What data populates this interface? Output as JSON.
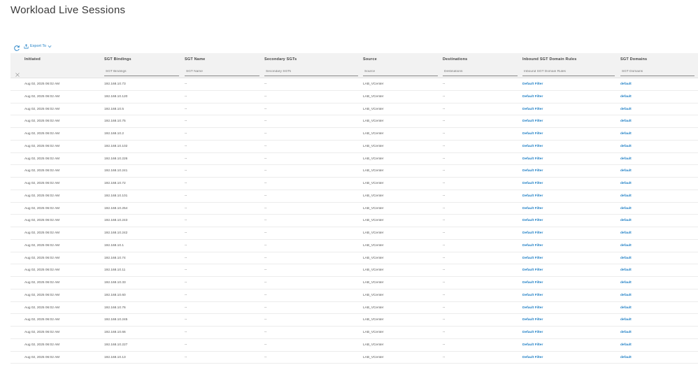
{
  "page": {
    "title": "Workload Live Sessions"
  },
  "toolbar": {
    "export_label": "Export To"
  },
  "table": {
    "columns": [
      "Initiated",
      "SGT Bindings",
      "SGT Name",
      "Secondary SGTs",
      "Source",
      "Destinations",
      "Inbound SGT Domain Rules",
      "SGT Domains"
    ],
    "filter_placeholders": [
      "",
      "SGT Bindings",
      "SGT Name",
      "Secondary SGTs",
      "Source",
      "Destinations",
      "Inbound SGT Domain Rules",
      "SGT Domains"
    ],
    "rows": [
      [
        "Aug 02, 2025 06:02 AM",
        "192.168.10.73",
        "--",
        "--",
        "LAB_VCenter",
        "--",
        "Default Filter",
        "default"
      ],
      [
        "Aug 02, 2025 06:02 AM",
        "192.168.10.120",
        "--",
        "--",
        "LAB_VCenter",
        "--",
        "Default Filter",
        "default"
      ],
      [
        "Aug 02, 2025 06:02 AM",
        "192.168.10.5",
        "--",
        "--",
        "LAB_VCenter",
        "--",
        "Default Filter",
        "default"
      ],
      [
        "Aug 02, 2025 06:02 AM",
        "192.168.10.75",
        "--",
        "--",
        "LAB_VCenter",
        "--",
        "Default Filter",
        "default"
      ],
      [
        "Aug 02, 2025 06:02 AM",
        "192.168.10.2",
        "--",
        "--",
        "LAB_VCenter",
        "--",
        "Default Filter",
        "default"
      ],
      [
        "Aug 02, 2025 06:02 AM",
        "192.168.10.102",
        "--",
        "--",
        "LAB_VCenter",
        "--",
        "Default Filter",
        "default"
      ],
      [
        "Aug 02, 2025 06:02 AM",
        "192.168.10.226",
        "--",
        "--",
        "LAB_VCenter",
        "--",
        "Default Filter",
        "default"
      ],
      [
        "Aug 02, 2025 06:02 AM",
        "192.168.10.241",
        "--",
        "--",
        "LAB_VCenter",
        "--",
        "Default Filter",
        "default"
      ],
      [
        "Aug 02, 2025 06:02 AM",
        "192.168.10.72",
        "--",
        "--",
        "LAB_VCenter",
        "--",
        "Default Filter",
        "default"
      ],
      [
        "Aug 02, 2025 06:02 AM",
        "192.168.10.101",
        "--",
        "--",
        "LAB_VCenter",
        "--",
        "Default Filter",
        "default"
      ],
      [
        "Aug 02, 2025 06:02 AM",
        "192.168.10.254",
        "--",
        "--",
        "LAB_VCenter",
        "--",
        "Default Filter",
        "default"
      ],
      [
        "Aug 02, 2025 06:02 AM",
        "192.168.10.243",
        "--",
        "--",
        "LAB_VCenter",
        "--",
        "Default Filter",
        "default"
      ],
      [
        "Aug 02, 2025 06:02 AM",
        "192.168.10.242",
        "--",
        "--",
        "LAB_VCenter",
        "--",
        "Default Filter",
        "default"
      ],
      [
        "Aug 02, 2025 06:02 AM",
        "192.168.10.1",
        "--",
        "--",
        "LAB_VCenter",
        "--",
        "Default Filter",
        "default"
      ],
      [
        "Aug 02, 2025 06:02 AM",
        "192.168.10.74",
        "--",
        "--",
        "LAB_VCenter",
        "--",
        "Default Filter",
        "default"
      ],
      [
        "Aug 02, 2025 06:02 AM",
        "192.168.10.11",
        "--",
        "--",
        "LAB_VCenter",
        "--",
        "Default Filter",
        "default"
      ],
      [
        "Aug 02, 2025 06:02 AM",
        "192.168.10.33",
        "--",
        "--",
        "LAB_VCenter",
        "--",
        "Default Filter",
        "default"
      ],
      [
        "Aug 02, 2025 06:02 AM",
        "192.168.10.60",
        "--",
        "--",
        "LAB_VCenter",
        "--",
        "Default Filter",
        "default"
      ],
      [
        "Aug 02, 2025 06:02 AM",
        "192.168.10.76",
        "--",
        "--",
        "LAB_VCenter",
        "--",
        "Default Filter",
        "default"
      ],
      [
        "Aug 02, 2025 06:02 AM",
        "192.168.10.245",
        "--",
        "--",
        "LAB_VCenter",
        "--",
        "Default Filter",
        "default"
      ],
      [
        "Aug 02, 2025 06:02 AM",
        "192.168.10.66",
        "--",
        "--",
        "LAB_VCenter",
        "--",
        "Default Filter",
        "default"
      ],
      [
        "Aug 02, 2025 06:02 AM",
        "192.168.10.227",
        "--",
        "--",
        "LAB_VCenter",
        "--",
        "Default Filter",
        "default"
      ],
      [
        "Aug 02, 2025 06:02 AM",
        "192.168.10.13",
        "--",
        "--",
        "LAB_VCenter",
        "--",
        "Default Filter",
        "default"
      ]
    ]
  },
  "icons": {
    "refresh": "refresh-icon",
    "export": "export-icon",
    "chevron": "chevron-down-icon",
    "clear": "close-icon"
  },
  "colors": {
    "link": "#1f7fc5",
    "header_bg": "#f2f2f2"
  }
}
